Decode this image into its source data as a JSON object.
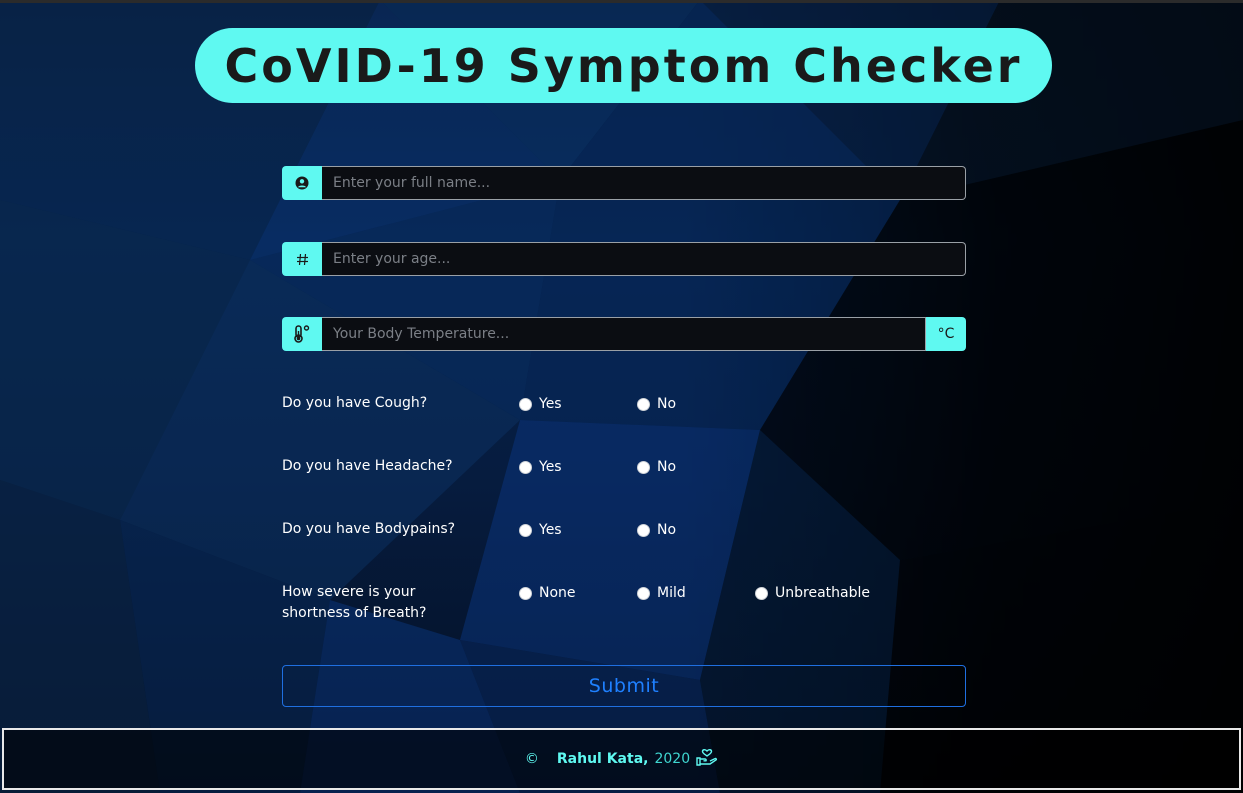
{
  "header": {
    "title": "CoVID-19 Symptom Checker"
  },
  "form": {
    "name_placeholder": "Enter your full name...",
    "age_placeholder": "Enter your age...",
    "temp_placeholder": "Your Body Temperature...",
    "temp_unit": "°C",
    "icons": {
      "name": "user-circle-icon",
      "age": "hash-icon",
      "temp": "thermometer-icon"
    },
    "questions": [
      {
        "label": "Do you have Cough?",
        "options": [
          "Yes",
          "No"
        ]
      },
      {
        "label": "Do you have Headache?",
        "options": [
          "Yes",
          "No"
        ]
      },
      {
        "label": "Do you have Bodypains?",
        "options": [
          "Yes",
          "No"
        ]
      },
      {
        "label": "How severe is your shortness of Breath?",
        "options": [
          "None",
          "Mild",
          "Unbreathable"
        ]
      }
    ],
    "submit_label": "Submit"
  },
  "footer": {
    "copyright": "©",
    "author": "Rahul Kata,",
    "year": "2020",
    "icon": "hand-heart-icon"
  },
  "colors": {
    "accent": "#5ff9f1",
    "submit": "#1f80ff",
    "background": "#061c3f"
  }
}
